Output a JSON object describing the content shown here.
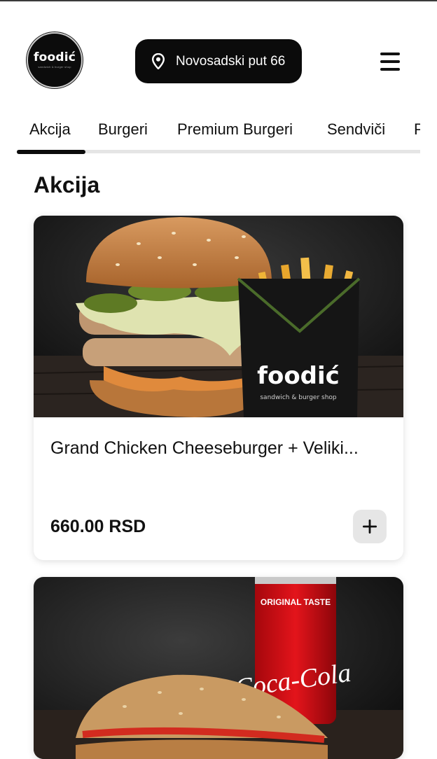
{
  "header": {
    "logo_text": "foodić",
    "logo_subtext": "sandwich & burger shop",
    "location_label": "Novosadski put 66"
  },
  "tabs": [
    {
      "label": "Akcija",
      "active": true
    },
    {
      "label": "Burgeri",
      "active": false
    },
    {
      "label": "Premium Burgeri",
      "active": false
    },
    {
      "label": "Sendviči",
      "active": false
    },
    {
      "label": "P",
      "active": false
    }
  ],
  "section": {
    "title": "Akcija"
  },
  "products": [
    {
      "name": "Grand Chicken Cheeseburger + Veliki...",
      "price": "660.00 RSD",
      "image_text": "foodić",
      "image_subtext": "sandwich & burger shop"
    },
    {
      "can_text": "ORIGINAL TASTE",
      "can_logo": "Coca-Cola"
    }
  ],
  "colors": {
    "primary": "#0b0b0b",
    "tab_track": "#e5e5e5",
    "add_button_bg": "#e6e6e6"
  },
  "icons": {
    "location": "location-pin-icon",
    "menu": "hamburger-menu-icon",
    "add": "plus-icon"
  }
}
